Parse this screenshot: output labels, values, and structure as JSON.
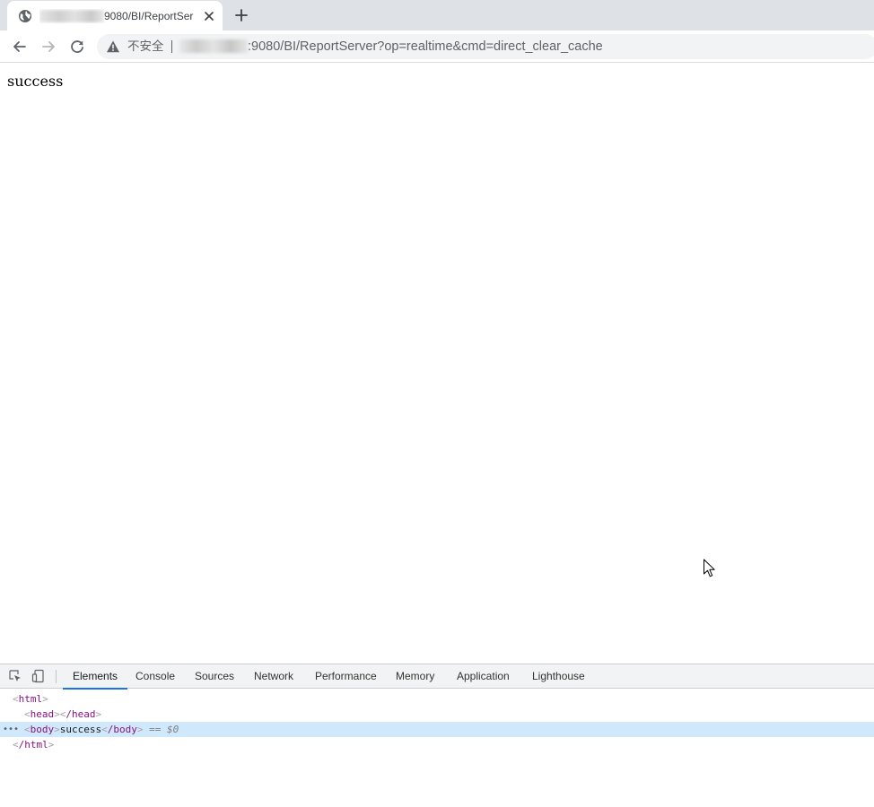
{
  "browser": {
    "tab": {
      "title_visible": "9080/BI/ReportSer"
    },
    "omnibox": {
      "security_label": "不安全",
      "url_visible": ":9080/BI/ReportServer?op=realtime&cmd=direct_clear_cache"
    },
    "icons": {
      "favicon": "globe-icon",
      "close": "close-icon",
      "new_tab": "plus-icon",
      "back": "arrow-left-icon",
      "forward": "arrow-right-icon",
      "reload": "reload-icon",
      "security": "warning-icon"
    }
  },
  "page": {
    "body_text": "success"
  },
  "devtools": {
    "tabs": [
      {
        "label": "Elements",
        "active": true
      },
      {
        "label": "Console"
      },
      {
        "label": "Sources"
      },
      {
        "label": "Network"
      },
      {
        "label": "Performance"
      },
      {
        "label": "Memory"
      },
      {
        "label": "Application"
      },
      {
        "label": "Lighthouse"
      }
    ],
    "tree": {
      "html_open": "html",
      "head_open": "head",
      "head_close": "/head",
      "body_open": "body",
      "body_text": "success",
      "body_close": "/body",
      "selected_marker": "== $0",
      "html_close": "/html",
      "dots": "•••"
    },
    "accent_color": "#1a73e8",
    "selected_row_color": "#cfe8fc",
    "tag_color": "#881280"
  }
}
